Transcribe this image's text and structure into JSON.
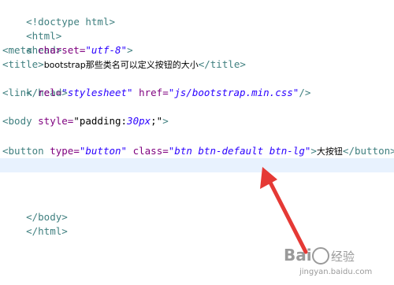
{
  "code": {
    "l1": {
      "tag": "<!doctype html>"
    },
    "l2": {
      "tag": "<html>"
    },
    "l3": {
      "tag": "<head>"
    },
    "l4": {
      "open": "<meta ",
      "attr": "charset=",
      "str": "\"utf-8\"",
      "close": ">"
    },
    "l5": {
      "open": "<title>",
      "text": "bootstrap那些类名可以定义按钮的大小",
      "close": "</title>"
    },
    "l6": {
      "tag": "</head>"
    },
    "l7": {
      "open": "<link ",
      "attr1": "rel=",
      "str1": "\"stylesheet\"",
      "attr2": " href=",
      "str2": "\"js/bootstrap.min.css\"",
      "close": "/>"
    },
    "l8": {
      "open": "<body ",
      "attr": "style=",
      "str_a": "\"padding:",
      "str_b": "30px",
      "str_c": ";\"",
      "close": ">"
    },
    "l9": {
      "open": "<button ",
      "attr1": "type=",
      "str1": "\"button\"",
      "attr2": " class=",
      "str2": "\"btn btn-default btn-lg\"",
      "close": ">",
      "text": "大按钮",
      "end": "</button>"
    },
    "l10": {
      "tag": "</body>"
    },
    "l11": {
      "tag": "</html>"
    }
  },
  "watermark": {
    "brand": "Bai",
    "brand_cn": "经验",
    "url": "jingyan.baidu.com"
  },
  "colors": {
    "tag": "#3f7f7f",
    "attr": "#7f007f",
    "string": "#2a00ff",
    "current_line": "#e8f2fe",
    "arrow": "#e53935"
  }
}
